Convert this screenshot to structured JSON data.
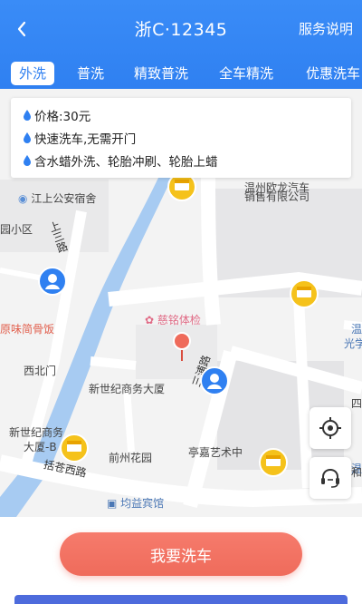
{
  "header": {
    "title": "浙C·12345",
    "help_label": "服务说明"
  },
  "tabs": [
    {
      "label": "外洗",
      "active": true
    },
    {
      "label": "普洗",
      "active": false
    },
    {
      "label": "精致普洗",
      "active": false
    },
    {
      "label": "全车精洗",
      "active": false
    },
    {
      "label": "优惠洗车",
      "active": false
    }
  ],
  "info": {
    "price": "价格:30元",
    "feature": "快速洗车,无需开门",
    "includes": "含水蜡外洗、轮胎冲刷、轮胎上蜡"
  },
  "map": {
    "labels": {
      "jiangshang": "江上公安宿舍",
      "auto_sales": "温州欧龙汽车",
      "auto_sales2": "销售有限公司",
      "xiaoqu": "园小区",
      "road_shangsan": "上三路",
      "noodle": "原味简骨饭",
      "wen": "温",
      "guangxue": "光学",
      "cimingtijian": "慈铭体检",
      "xibeimen": "西北门",
      "xinshiji": "新世纪商务大厦",
      "road_sanpu": "三浦路",
      "xinshiji2a": "新世纪商务",
      "xinshiji2b": "大厦-B",
      "qianzhou": "前州花园",
      "tingjia": "亭嘉艺术中",
      "road_kuoxi": "括苍西路",
      "junyi": "均益宾馆",
      "si": "四",
      "wen2": "温",
      "he": "和"
    }
  },
  "bottom": {
    "wash_label": "我要洗车"
  },
  "colors": {
    "primary": "#2f80f1",
    "accent": "#ef6b5b",
    "marker_yellow": "#f5c21b"
  }
}
